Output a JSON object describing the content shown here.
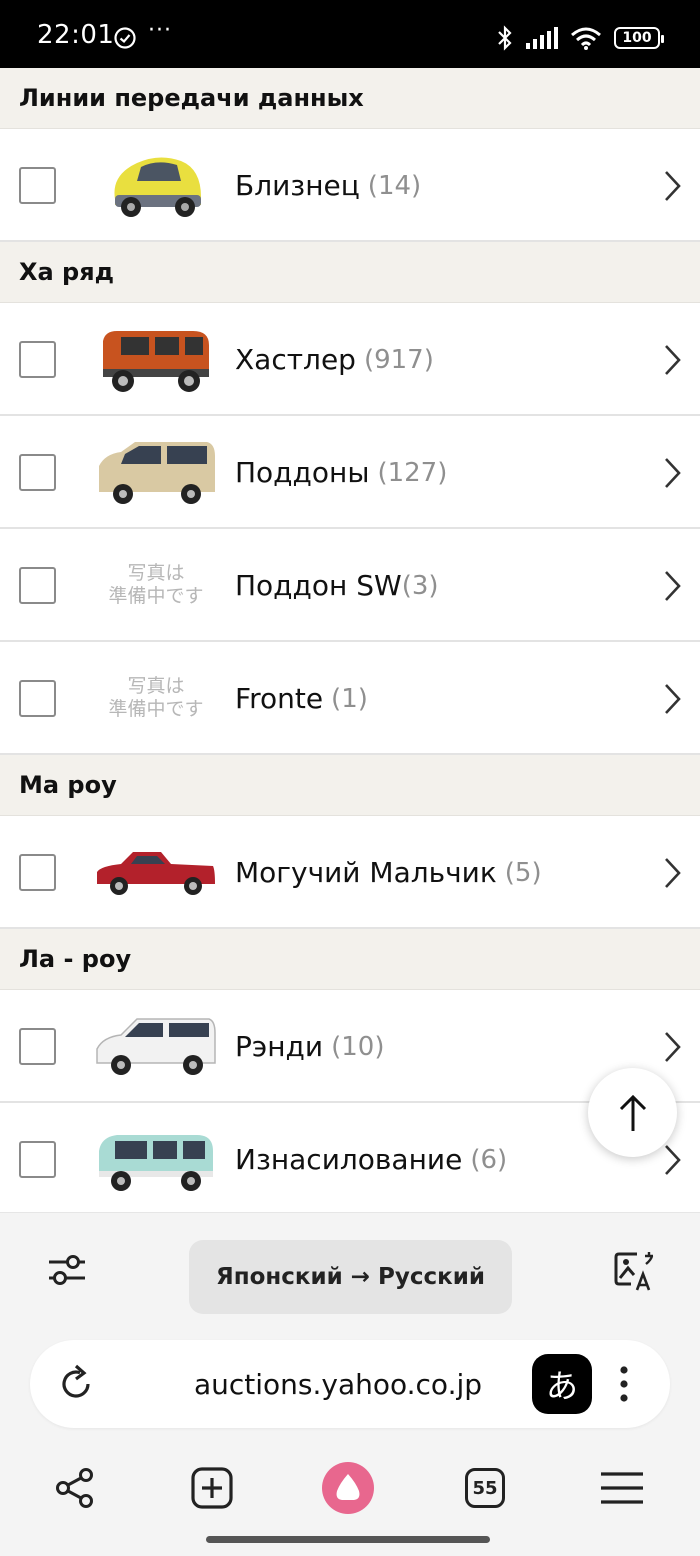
{
  "status_bar": {
    "time": "22:01",
    "dots": "···",
    "battery": "100",
    "icons": [
      "check-circle-icon",
      "bluetooth-icon",
      "signal-icon",
      "wifi-icon",
      "battery-icon"
    ]
  },
  "list": {
    "sections": [
      {
        "header": "Линии передачи данных",
        "items": [
          {
            "name": "Близнец",
            "count": "(14)",
            "thumb": "yellow-car"
          }
        ]
      },
      {
        "header": "Ха ряд",
        "items": [
          {
            "name": "Хастлер",
            "count": "(917)",
            "thumb": "orange-suv"
          },
          {
            "name": "Поддоны",
            "count": "(127)",
            "thumb": "beige-van"
          },
          {
            "name": "Поддон SW",
            "count": "(3)",
            "thumb": "placeholder"
          },
          {
            "name": "Fronte",
            "count": "(1)",
            "thumb": "placeholder"
          }
        ]
      },
      {
        "header": "Ма роу",
        "items": [
          {
            "name": "Могучий Мальчик",
            "count": "(5)",
            "thumb": "red-pickup"
          }
        ]
      },
      {
        "header": "Ла - роу",
        "items": [
          {
            "name": "Рэнди",
            "count": "(10)",
            "thumb": "white-van"
          },
          {
            "name": "Изнасилование",
            "count": "(6)",
            "thumb": "mint-car"
          }
        ]
      }
    ],
    "placeholder_line1": "写真は",
    "placeholder_line2": "準備中です"
  },
  "translate_bar": {
    "language_pair": "Японский → Русский",
    "icons": [
      "settings-sliders-icon",
      "image-translate-icon"
    ]
  },
  "url_bar": {
    "url": "auctions.yahoo.co.jp",
    "translate_glyph": "あ",
    "icons": [
      "reload-icon",
      "more-vert-icon"
    ]
  },
  "bottom_nav": {
    "tabs_count": "55",
    "icons": [
      "share-icon",
      "new-tab-icon",
      "assistant-icon",
      "tabs-icon",
      "menu-icon"
    ]
  },
  "colors": {
    "section_bg": "#f3f1ec",
    "assistant_accent": "#e8678e",
    "count_gray": "#8f8f8f"
  }
}
